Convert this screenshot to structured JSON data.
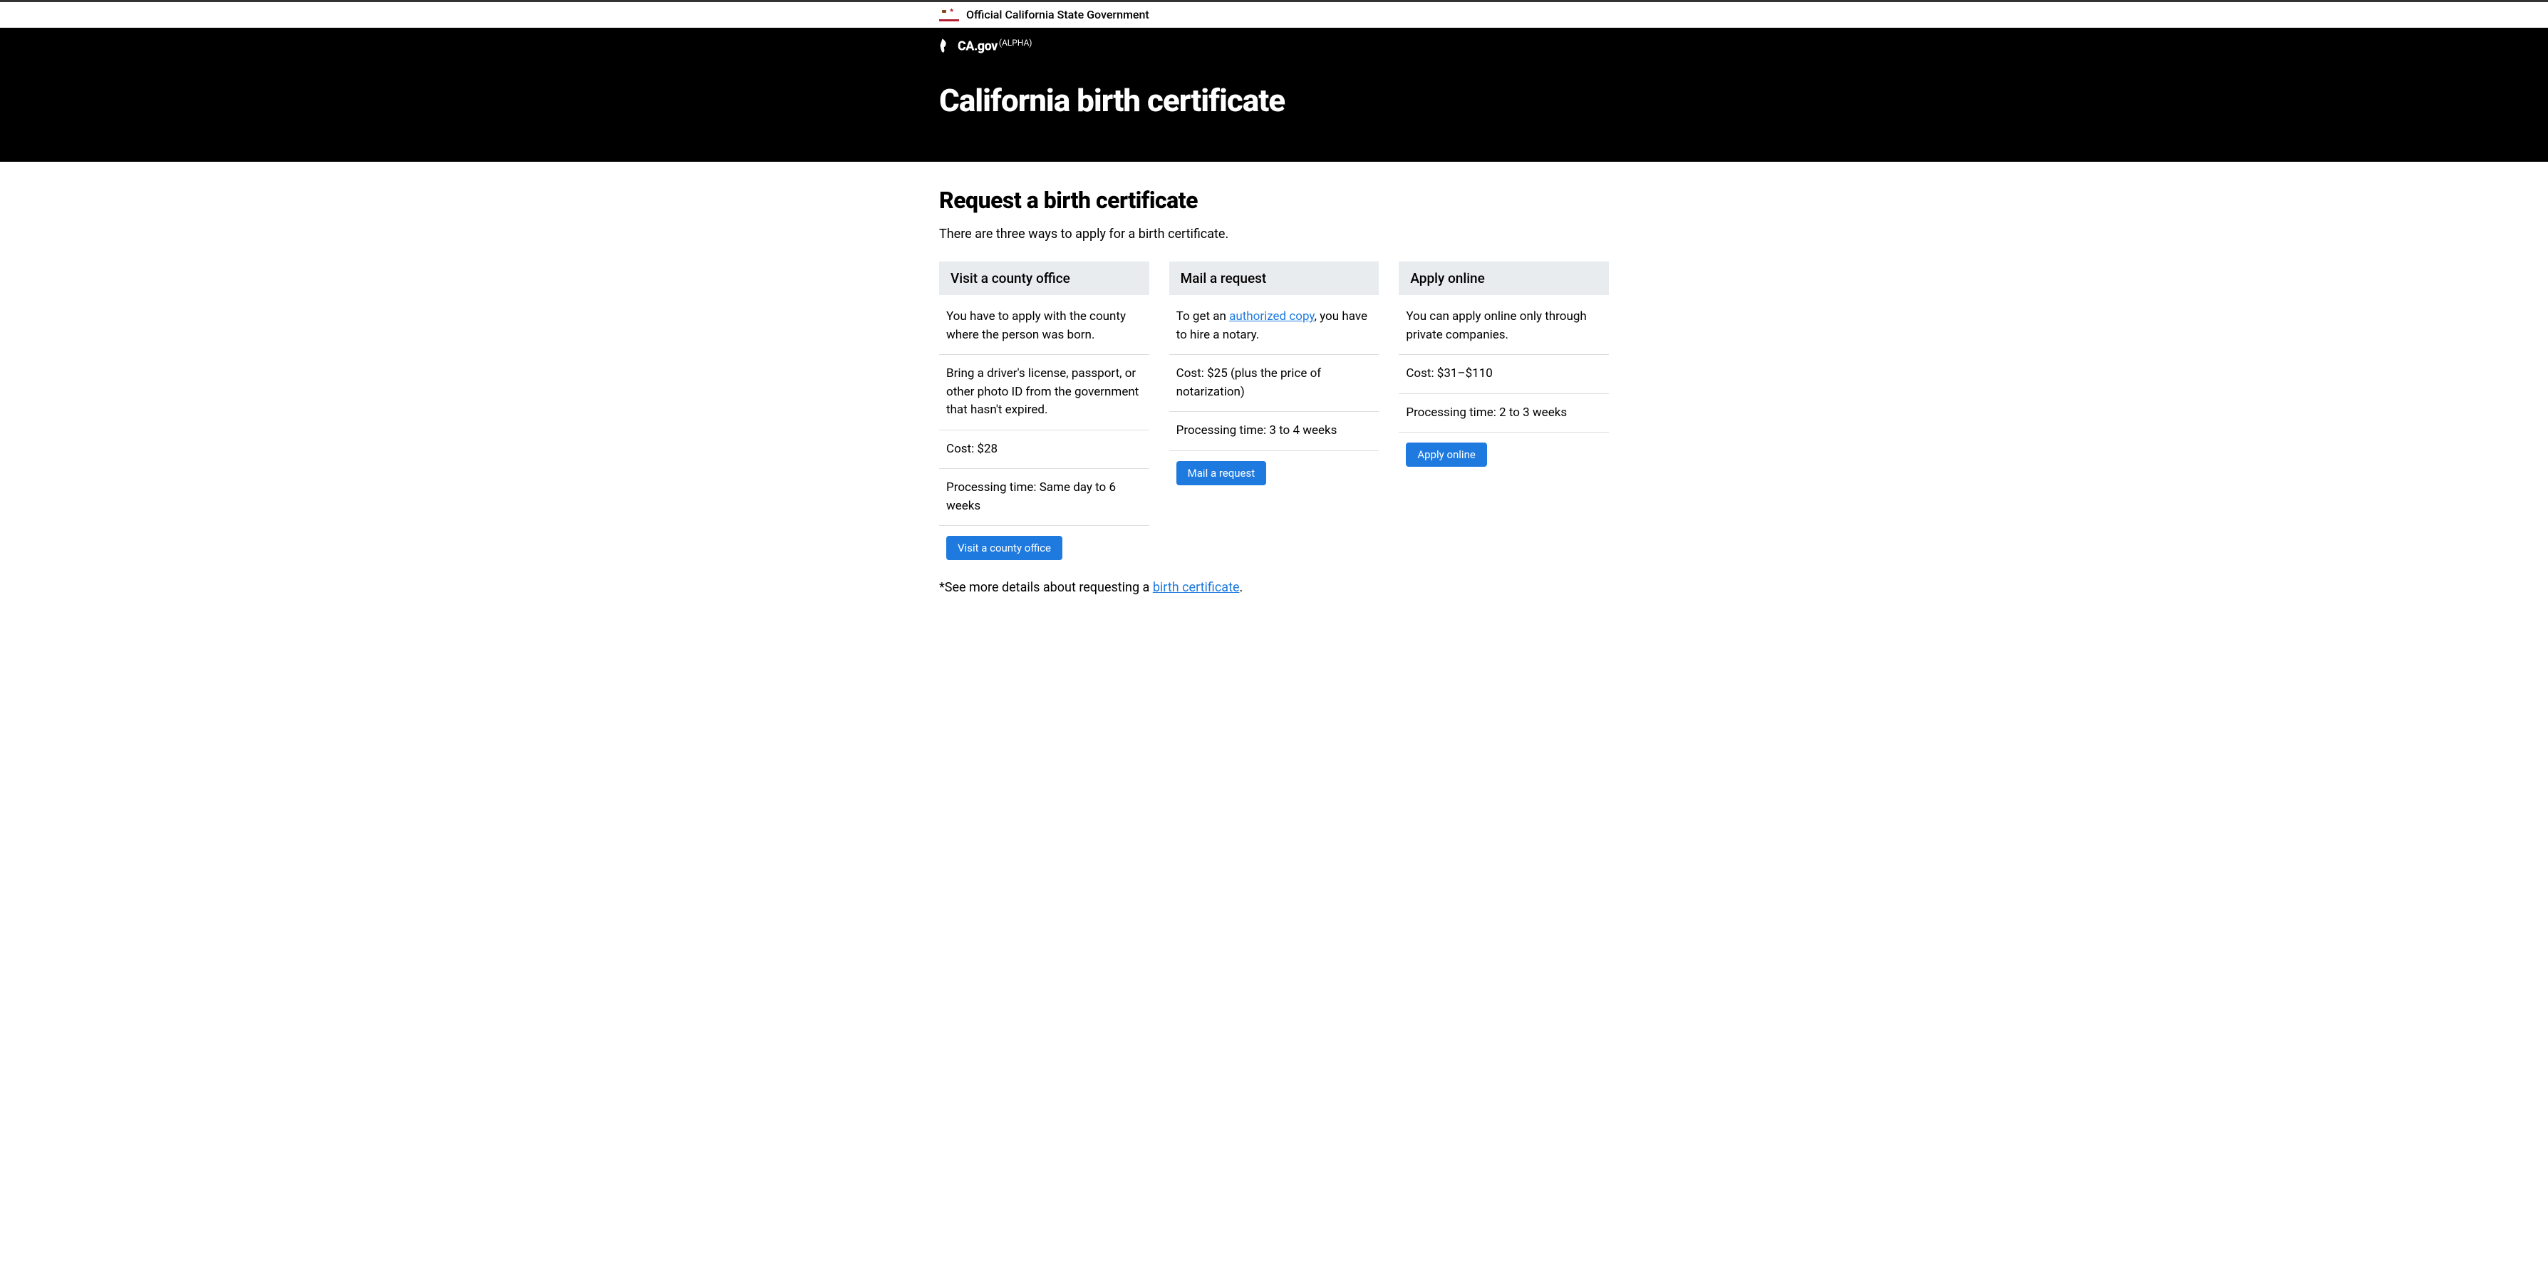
{
  "banner": {
    "text": "Official California State Government"
  },
  "nav": {
    "brand": "CA.gov",
    "suffix": "(ALPHA)"
  },
  "page": {
    "title": "California birth certificate",
    "heading": "Request a birth certificate",
    "intro": "There are three ways to apply for a birth certificate."
  },
  "cards": [
    {
      "title": "Visit a county office",
      "desc": "You have to apply with the county where the person was born.",
      "bring": "Bring a driver's license, passport, or other photo ID from the government that hasn't expired.",
      "cost": "Cost: $28",
      "time": "Processing time: Same day to 6 weeks",
      "button": "Visit a county office"
    },
    {
      "title": "Mail a request",
      "desc_pre": "To get an ",
      "desc_link": "authorized copy",
      "desc_post": ", you have to hire a notary.",
      "cost": "Cost: $25 (plus the price of notarization)",
      "time": "Processing time: 3 to 4 weeks",
      "button": "Mail a request"
    },
    {
      "title": "Apply online",
      "desc": "You can apply online only through private companies.",
      "cost": "Cost: $31–$110",
      "time": "Processing time: 2 to 3 weeks",
      "button": "Apply online"
    }
  ],
  "footnote": {
    "pre": "*See more details about requesting a ",
    "link": "birth certificate",
    "post": "."
  }
}
